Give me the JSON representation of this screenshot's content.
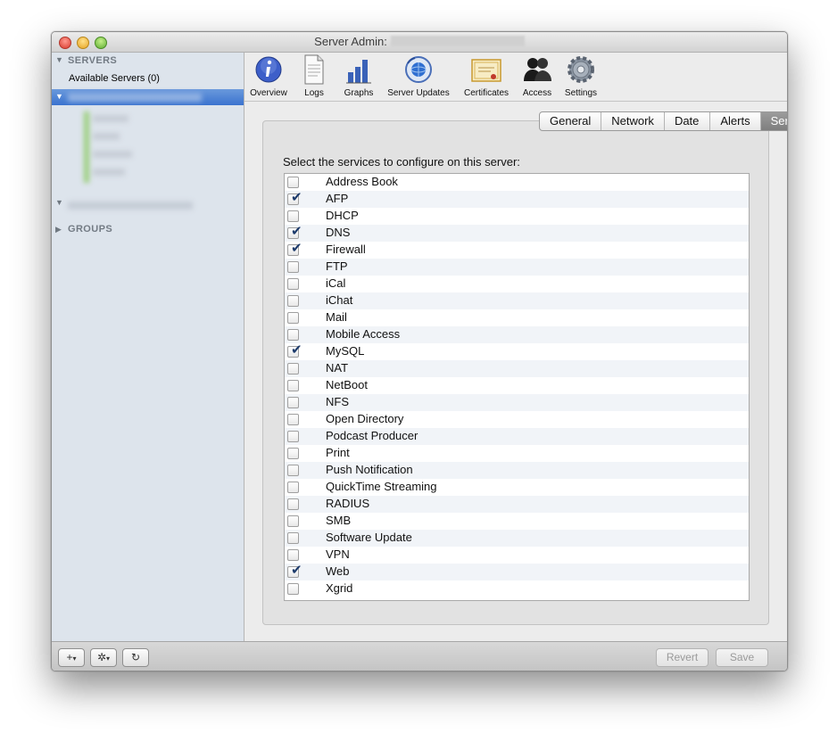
{
  "window": {
    "title": "Server Admin:"
  },
  "sidebar": {
    "servers_header": "SERVERS",
    "available_servers": "Available Servers (0)",
    "groups_header": "GROUPS"
  },
  "toolbar": {
    "items": [
      {
        "label": "Overview",
        "icon": "info-icon"
      },
      {
        "label": "Logs",
        "icon": "document-icon"
      },
      {
        "label": "Graphs",
        "icon": "bar-graph-icon"
      },
      {
        "label": "Server Updates",
        "icon": "globe-update-icon"
      },
      {
        "label": "Certificates",
        "icon": "certificate-icon"
      },
      {
        "label": "Access",
        "icon": "users-icon"
      },
      {
        "label": "Settings",
        "icon": "gear-icon"
      }
    ]
  },
  "tabs": [
    {
      "label": "General",
      "active": false
    },
    {
      "label": "Network",
      "active": false
    },
    {
      "label": "Date & Time",
      "active": false
    },
    {
      "label": "Alerts",
      "active": false
    },
    {
      "label": "Services",
      "active": true
    }
  ],
  "services_prompt": "Select the services to configure on this server:",
  "services": [
    {
      "name": "Address Book",
      "checked": false
    },
    {
      "name": "AFP",
      "checked": true
    },
    {
      "name": "DHCP",
      "checked": false
    },
    {
      "name": "DNS",
      "checked": true
    },
    {
      "name": "Firewall",
      "checked": true
    },
    {
      "name": "FTP",
      "checked": false
    },
    {
      "name": "iCal",
      "checked": false
    },
    {
      "name": "iChat",
      "checked": false
    },
    {
      "name": "Mail",
      "checked": false
    },
    {
      "name": "Mobile Access",
      "checked": false
    },
    {
      "name": "MySQL",
      "checked": true
    },
    {
      "name": "NAT",
      "checked": false
    },
    {
      "name": "NetBoot",
      "checked": false
    },
    {
      "name": "NFS",
      "checked": false
    },
    {
      "name": "Open Directory",
      "checked": false
    },
    {
      "name": "Podcast Producer",
      "checked": false
    },
    {
      "name": "Print",
      "checked": false
    },
    {
      "name": "Push Notification",
      "checked": false
    },
    {
      "name": "QuickTime Streaming",
      "checked": false
    },
    {
      "name": "RADIUS",
      "checked": false
    },
    {
      "name": "SMB",
      "checked": false
    },
    {
      "name": "Software Update",
      "checked": false
    },
    {
      "name": "VPN",
      "checked": false
    },
    {
      "name": "Web",
      "checked": true
    },
    {
      "name": "Xgrid",
      "checked": false
    }
  ],
  "bottom": {
    "add_icon": "+",
    "action_icon": "✲",
    "refresh_icon": "↻",
    "revert_label": "Revert",
    "save_label": "Save"
  },
  "colors": {
    "selection": "#3a73cf",
    "sidebar_bg": "#dde4ec",
    "check": "#1c3a6b"
  }
}
